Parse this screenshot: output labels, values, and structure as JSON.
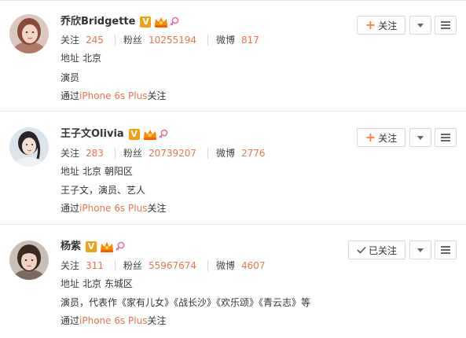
{
  "users": [
    {
      "name": "乔欣Bridgette",
      "verified_mark": "V",
      "stats": [
        {
          "label": "关注",
          "value": "245"
        },
        {
          "label": "粉丝",
          "value": "10255194"
        },
        {
          "label": "微博",
          "value": "817"
        }
      ],
      "address_label": "地址",
      "address": "北京",
      "bio": "演员",
      "via_prefix": "通过",
      "via_device": "iPhone 6s Plus",
      "via_suffix": "关注",
      "follow_label": "关注",
      "following": false
    },
    {
      "name": "王子文Olivia",
      "verified_mark": "V",
      "stats": [
        {
          "label": "关注",
          "value": "283"
        },
        {
          "label": "粉丝",
          "value": "20739207"
        },
        {
          "label": "微博",
          "value": "2776"
        }
      ],
      "address_label": "地址",
      "address": "北京 朝阳区",
      "bio": "王子文，演员、艺人",
      "via_prefix": "通过",
      "via_device": "iPhone 6s Plus",
      "via_suffix": "关注",
      "follow_label": "关注",
      "following": false
    },
    {
      "name": "杨紫",
      "verified_mark": "V",
      "stats": [
        {
          "label": "关注",
          "value": "311"
        },
        {
          "label": "粉丝",
          "value": "55967674"
        },
        {
          "label": "微博",
          "value": "4607"
        }
      ],
      "address_label": "地址",
      "address": "北京 东城区",
      "bio": "演员，代表作《家有儿女》《战长沙》《欢乐颂》《青云志》等",
      "via_prefix": "通过",
      "via_device": "iPhone 6s Plus",
      "via_suffix": "关注",
      "follow_label": "已关注",
      "following": true
    }
  ],
  "colors": {
    "accent_orange": "#eb7350",
    "verified_gold": "#f0a010",
    "crown_orange": "#ff8a00",
    "female_pink": "#e86cb0",
    "divider": "#e6e6e6"
  },
  "icons": {
    "verified": "verified-v-icon",
    "member_crown": "crown-icon",
    "gender": "female-icon",
    "follow_plus": "plus-icon",
    "followed_check": "check-icon",
    "more": "chevron-down-icon",
    "menu": "hamburger-menu-icon"
  }
}
